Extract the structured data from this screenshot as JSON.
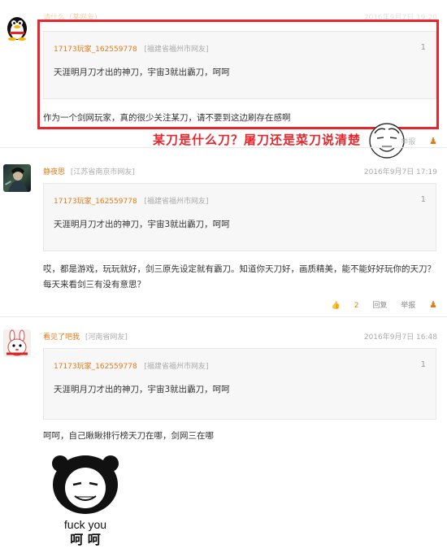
{
  "comment1": {
    "username": "请什么（某网友）",
    "time": "2016年9月7日 19:20",
    "quote": {
      "user": "17173玩家_162559778",
      "loc": "[福建省福州市网友]",
      "floor": "1",
      "text": "天涯明月刀才出的神刀，宇宙3就出霸刀，呵呵"
    },
    "text": "作为一个剑网玩家，真的很少关注某刀，请不要到这边刷存在感啊",
    "report": "举报",
    "annotation": "某刀是什么刀？屠刀还是菜刀说清楚"
  },
  "comment2": {
    "username": "静夜思",
    "loc": "[江苏省南京市网友]",
    "time": "2016年9月7日 17:19",
    "quote": {
      "user": "17173玩家_162559778",
      "loc": "[福建省福州市网友]",
      "floor": "1",
      "text": "天涯明月刀才出的神刀，宇宙3就出霸刀，呵呵"
    },
    "text": "哎，都是游戏，玩玩就好，剑三原先设定就有霸刀。知道你天刀好，画质精美，能不能好好玩你的天刀？每天来看剑三有没有意思？",
    "likes": "2",
    "reply": "回复",
    "report": "举报"
  },
  "comment3": {
    "username": "看见了吧我",
    "loc": "[河南省网友]",
    "time": "2016年9月7日 16:48",
    "quote": {
      "user": "17173玩家_162559778",
      "loc": "[福建省福州市网友]",
      "floor": "1",
      "text": "天涯明月刀才出的神刀，宇宙3就出霸刀，呵呵"
    },
    "text": "呵呵，自己瞅瞅排行榜天刀在哪，剑网三在哪",
    "meme_line1": "fuck you",
    "meme_line2": "呵 呵"
  },
  "colors": {
    "accent": "#e8262d",
    "username": "#e07b1a",
    "muted": "#aaaaaa",
    "quote_bg": "#f7f7f7",
    "like": "#e07b1a"
  },
  "icons": [
    "qq-penguin-avatar",
    "game-character-avatar",
    "rabbit-avatar",
    "thumbs-up-icon",
    "person-icon",
    "meme-face"
  ]
}
